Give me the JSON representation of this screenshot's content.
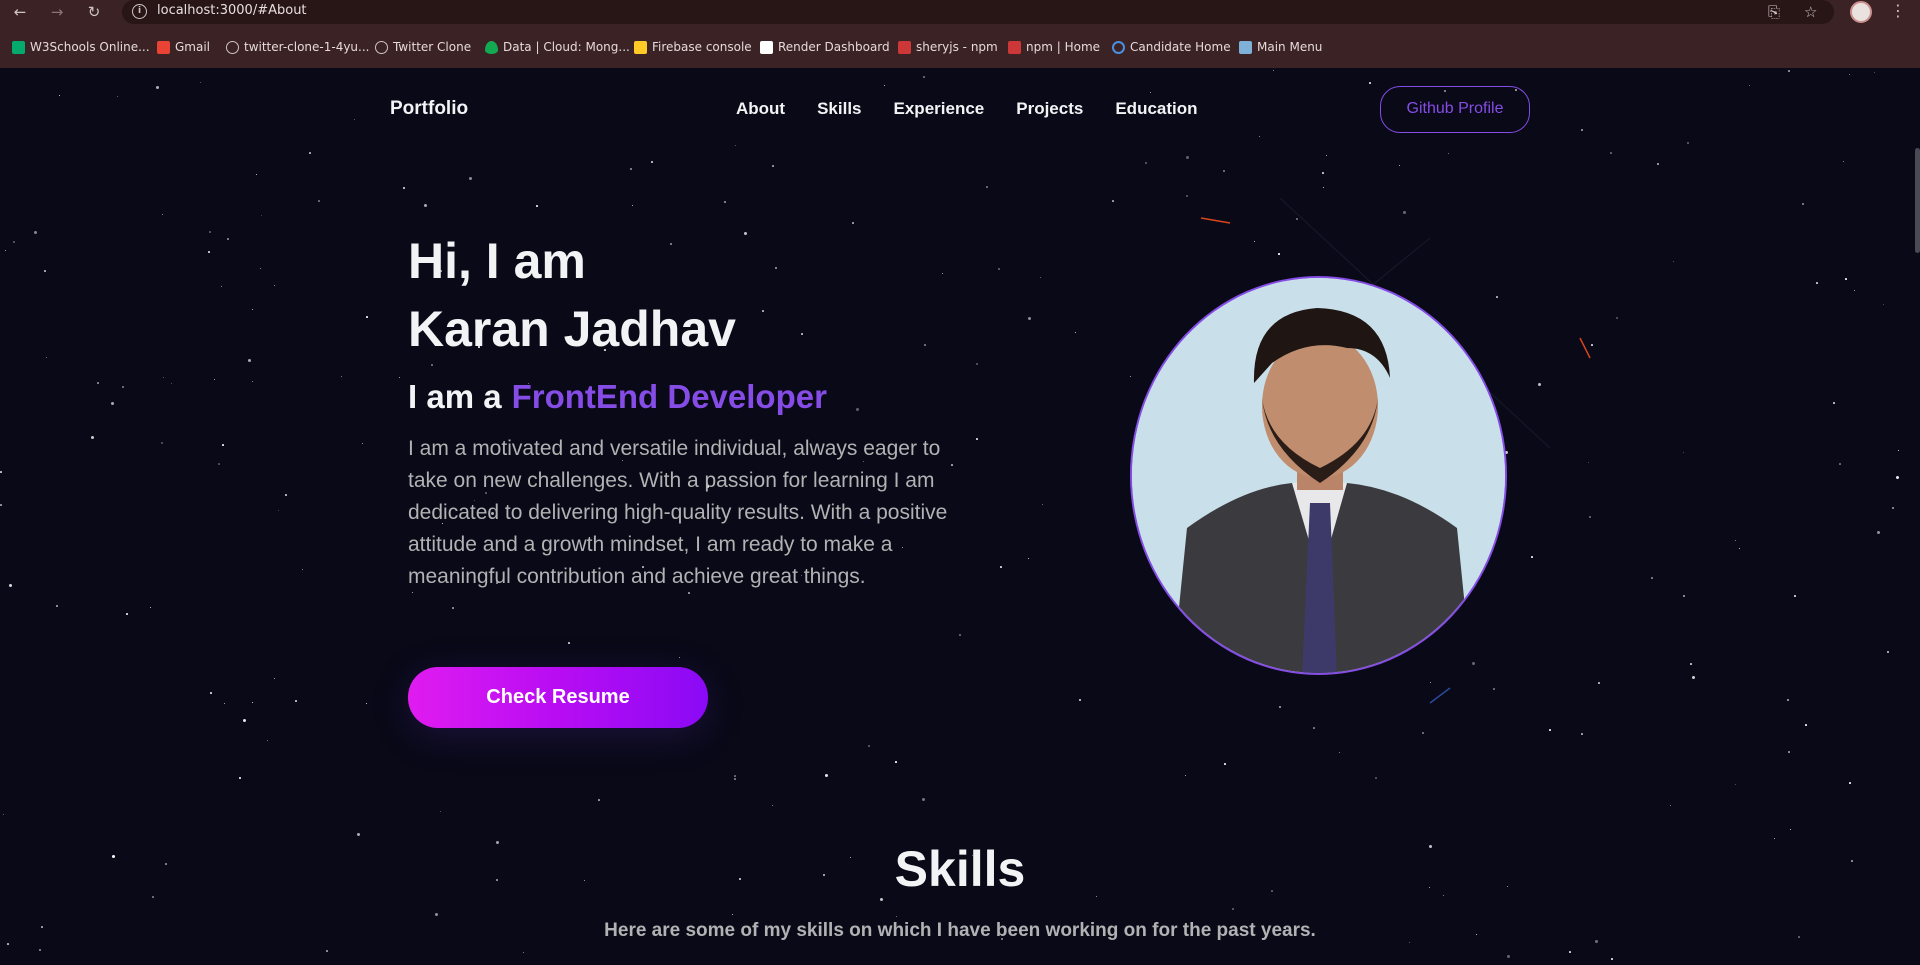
{
  "browser": {
    "url": "localhost:3000/#About",
    "bookmarks": [
      {
        "label": "W3Schools Online...",
        "icon": "w3schools-icon",
        "color": "#04aa6d"
      },
      {
        "label": "Gmail",
        "icon": "gmail-icon",
        "color": "#ea4335"
      },
      {
        "label": "twitter-clone-1-4yu...",
        "icon": "globe-icon",
        "color": "#cfc4c4"
      },
      {
        "label": "Twitter Clone",
        "icon": "globe-icon",
        "color": "#cfc4c4"
      },
      {
        "label": "Data | Cloud: Mong...",
        "icon": "mongodb-icon",
        "color": "#13aa52"
      },
      {
        "label": "Firebase console",
        "icon": "firebase-icon",
        "color": "#ffca28"
      },
      {
        "label": "Render Dashboard",
        "icon": "render-icon",
        "color": "#ffffff"
      },
      {
        "label": "sheryjs - npm",
        "icon": "npm-icon",
        "color": "#cb3837"
      },
      {
        "label": "npm | Home",
        "icon": "npm-icon",
        "color": "#cb3837"
      },
      {
        "label": "Candidate Home",
        "icon": "headset-icon",
        "color": "#4a8fe0"
      },
      {
        "label": "Main Menu",
        "icon": "menu-app-icon",
        "color": "#7fb0d8"
      }
    ]
  },
  "navbar": {
    "brand": "Portfolio",
    "links": [
      "About",
      "Skills",
      "Experience",
      "Projects",
      "Education"
    ],
    "github_button": "Github Profile"
  },
  "hero": {
    "greeting_line1": "Hi, I am",
    "name": "Karan Jadhav",
    "role_prefix": "I am a",
    "role_typed": "FrontEnd Developer",
    "description": "I am a motivated and versatile individual, always eager to take on new challenges. With a passion for learning I am dedicated to delivering high-quality results. With a positive attitude and a growth mindset, I am ready to make a meaningful contribution and achieve great things.",
    "resume_button": "Check Resume"
  },
  "skills": {
    "title": "Skills",
    "subtitle": "Here are some of my skills on which I have been working on for the past years."
  },
  "colors": {
    "background": "#090917",
    "accent": "#854ce6",
    "text_primary": "#f2f3f4",
    "text_secondary": "#b1b2b3",
    "chrome": "#3b2224"
  }
}
